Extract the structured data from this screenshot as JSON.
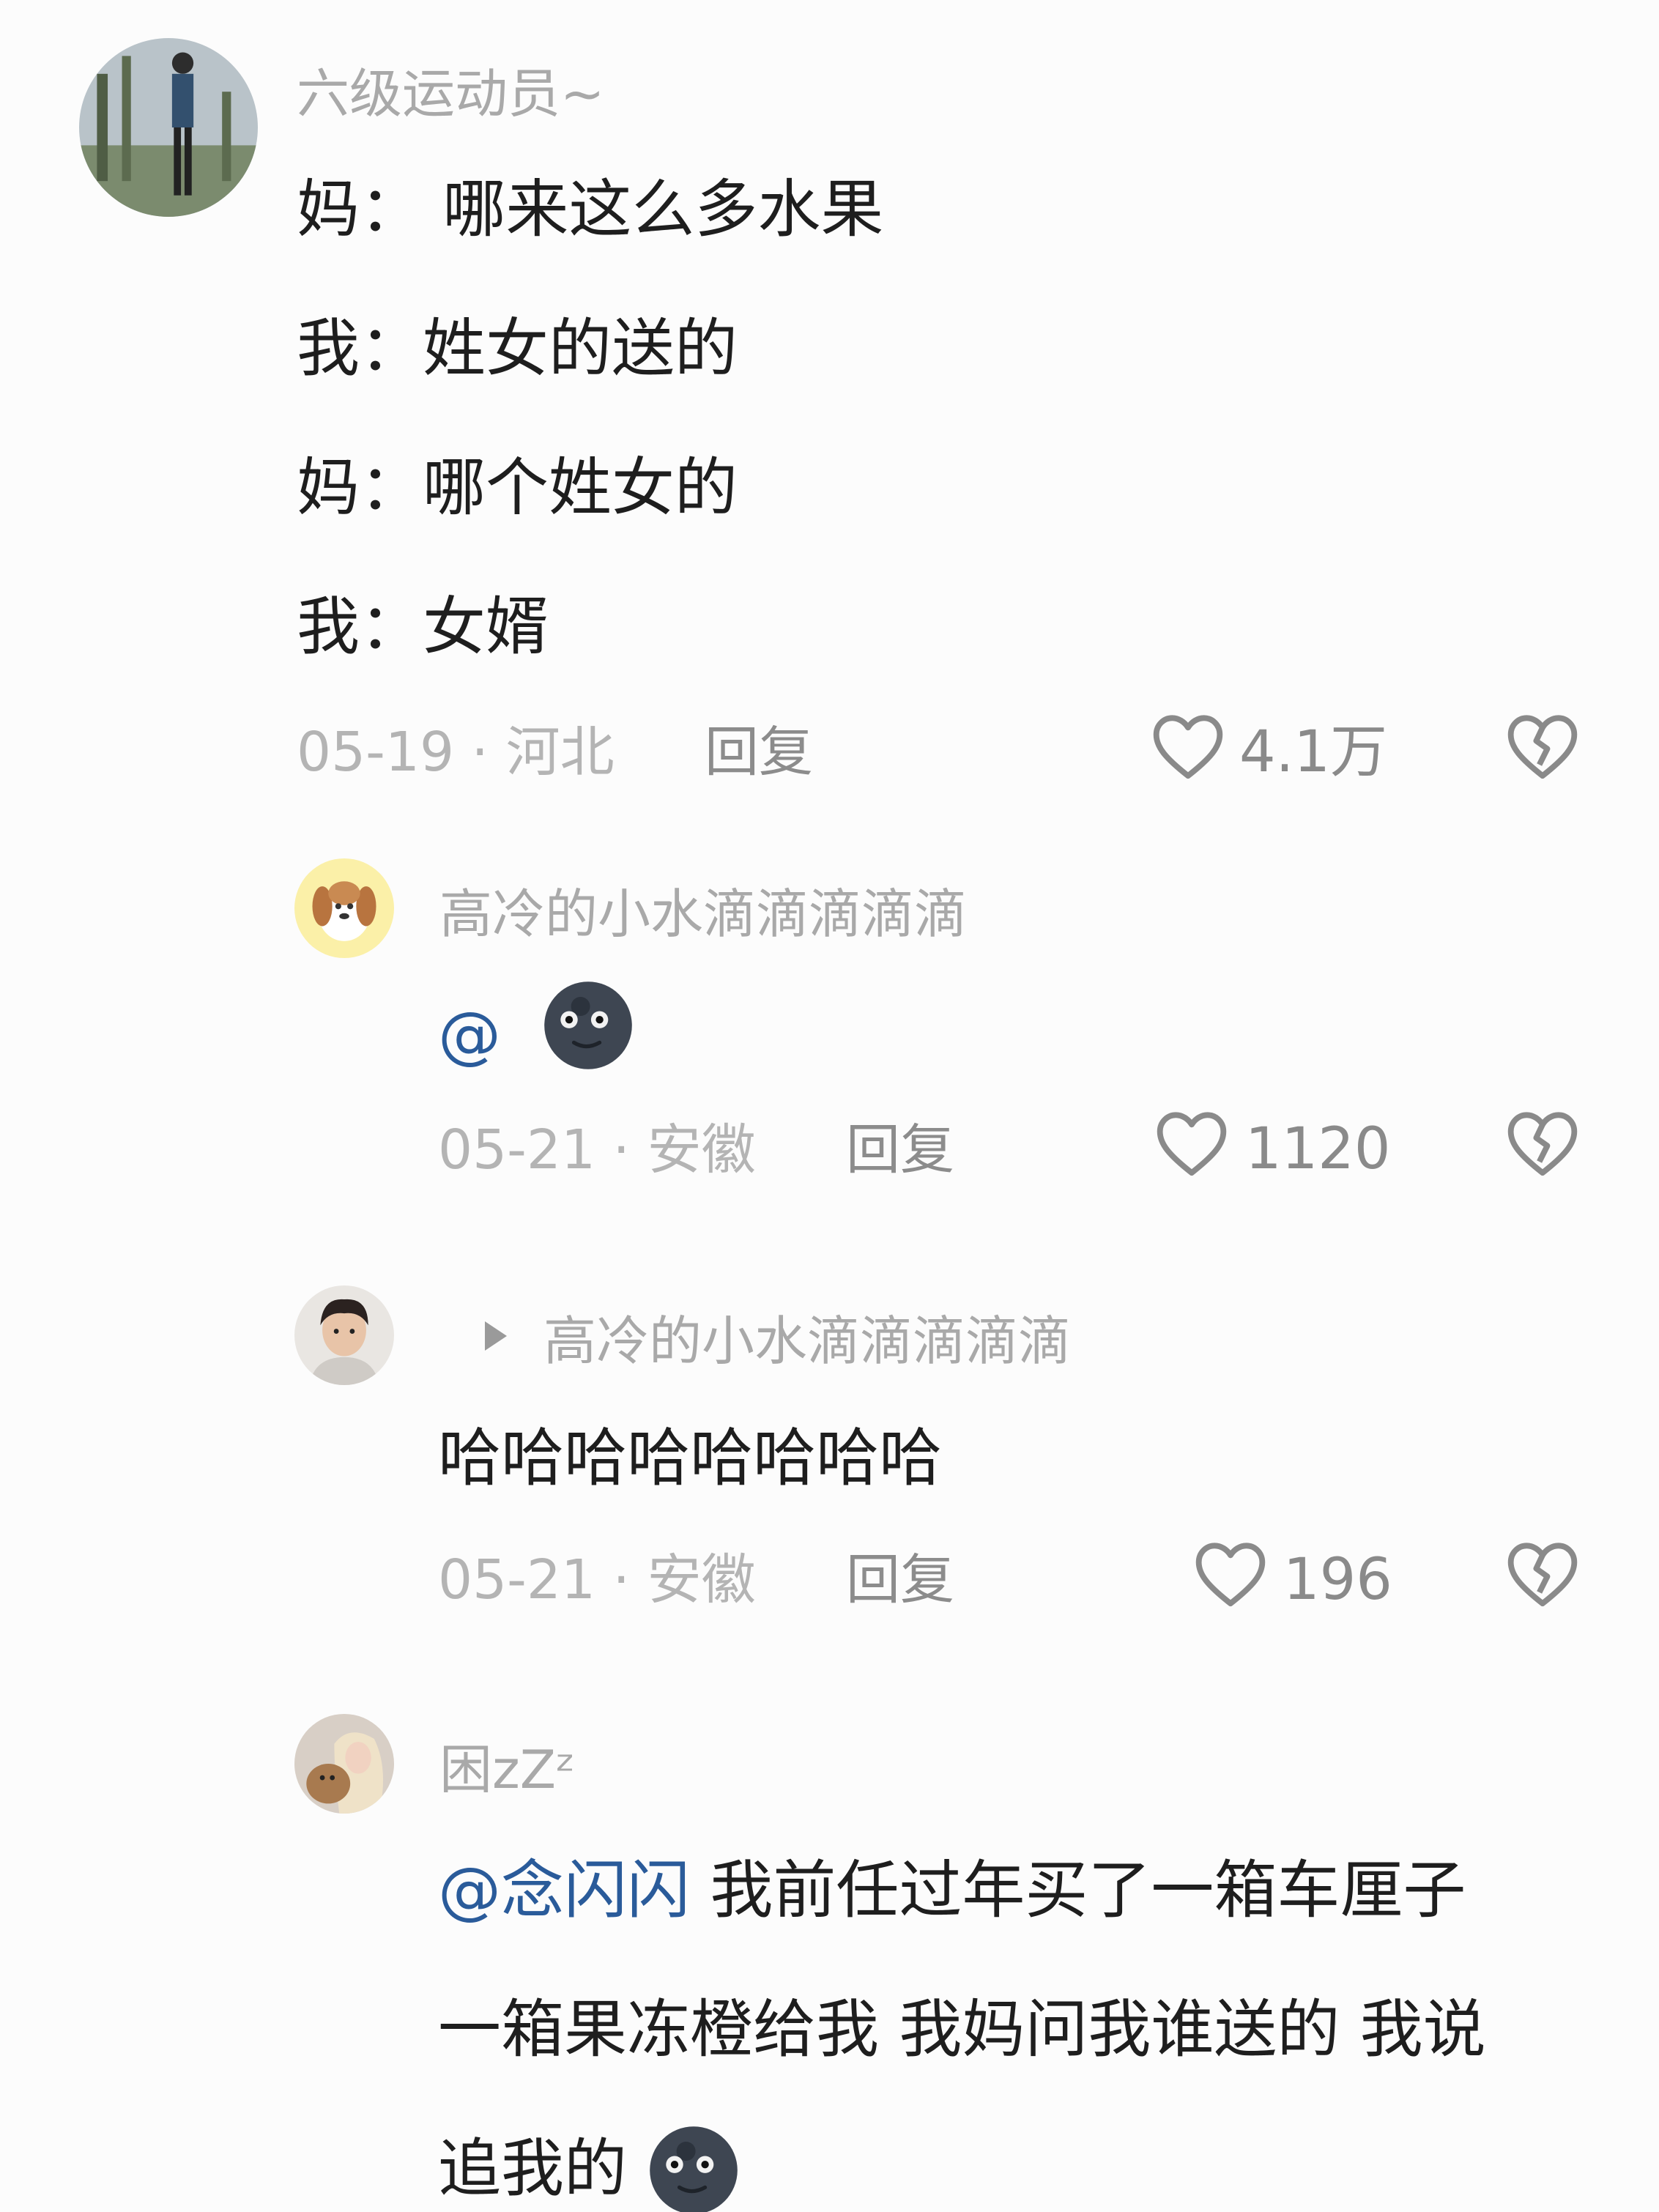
{
  "comments": [
    {
      "username": "六级运动员~",
      "lines": [
        "妈：  哪来这么多水果",
        "我：姓女的送的",
        "妈：哪个姓女的",
        "我：女婿"
      ],
      "date_location": "05-19 · 河北",
      "reply_label": "回复",
      "likes": "4.1万"
    },
    {
      "username": "高冷的小水滴滴滴滴滴",
      "mention": "@",
      "date_location": "05-21 · 安徽",
      "reply_label": "回复",
      "likes": "1120"
    },
    {
      "username": "高冷的小水滴滴滴滴滴",
      "text": "哈哈哈哈哈哈哈哈",
      "date_location": "05-21 · 安徽",
      "reply_label": "回复",
      "likes": "196"
    },
    {
      "username": "困zZᶻ",
      "mention": "@念闪闪",
      "line1": " 我前任过年买了一箱车厘子",
      "line2": "一箱果冻橙给我 我妈问我谁送的 我说",
      "line3": "追我的"
    }
  ],
  "icons": {
    "like": "heart-outline-icon",
    "dislike": "broken-heart-icon",
    "emoji": "new-moon-face-emoji"
  },
  "colors": {
    "username": "#a9a9a9",
    "text": "#1e1e1e",
    "mention": "#2a5b9a",
    "meta": "#b4b4b4"
  }
}
